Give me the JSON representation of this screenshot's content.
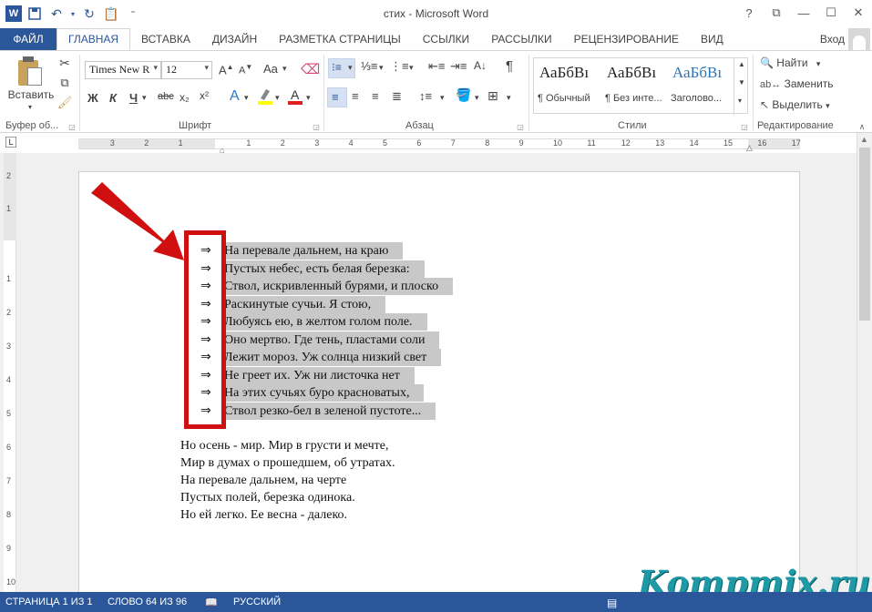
{
  "window": {
    "title": "стих - Microsoft Word",
    "login": "Вход",
    "controls": [
      "?",
      "⧉",
      "—",
      "☐",
      "✕"
    ]
  },
  "tabs": [
    {
      "label": "ФАЙЛ"
    },
    {
      "label": "ГЛАВНАЯ"
    },
    {
      "label": "ВСТАВКА"
    },
    {
      "label": "ДИЗАЙН"
    },
    {
      "label": "РАЗМЕТКА СТРАНИЦЫ"
    },
    {
      "label": "ССЫЛКИ"
    },
    {
      "label": "РАССЫЛКИ"
    },
    {
      "label": "РЕЦЕНЗИРОВАНИЕ"
    },
    {
      "label": "ВИД"
    }
  ],
  "ribbon": {
    "clipboard": {
      "paste_label": "Вставить",
      "group": "Буфер об..."
    },
    "font": {
      "group": "Шрифт",
      "font_name": "Times New R",
      "font_size": "12",
      "bold": "Ж",
      "italic": "К",
      "underline": "Ч",
      "strike": "abc",
      "sub": "x₂",
      "sup": "x²",
      "case": "Aa"
    },
    "paragraph": {
      "group": "Абзац"
    },
    "styles": {
      "group": "Стили",
      "items": [
        {
          "preview": "АаБбВı",
          "name": "¶ Обычный"
        },
        {
          "preview": "АаБбВı",
          "name": "¶ Без инте..."
        },
        {
          "preview": "АаБбВı",
          "name": "Заголово..."
        }
      ]
    },
    "editing": {
      "group": "Редактирование",
      "find": "Найти",
      "replace": "Заменить",
      "select": "Выделить"
    }
  },
  "ruler": {
    "h_numbers": [
      "3",
      "2",
      "1",
      "1",
      "2",
      "3",
      "4",
      "5",
      "6",
      "7",
      "8",
      "9",
      "10",
      "11",
      "12",
      "13",
      "14",
      "15",
      "16",
      "17"
    ],
    "v_numbers": [
      "2",
      "1",
      "1",
      "2",
      "3",
      "4",
      "5",
      "6",
      "7",
      "8",
      "9",
      "10"
    ]
  },
  "document": {
    "bullet_symbol": "⇒",
    "bulleted_lines": [
      "На перевале дальнем, на краю",
      "Пустых небес, есть белая березка:",
      "Ствол, искривленный бурями, и плоско",
      "Раскинутые сучьи. Я стою,",
      "Любуясь ею, в желтом голом поле.",
      "Оно мертво. Где тень, пластами соли",
      "Лежит мороз. Уж солнца низкий свет",
      "Не греет их. Уж ни листочка нет",
      "На этих сучьях буро красноватых,",
      "Ствол резко-бел в зеленой пустоте..."
    ],
    "plain_lines": [
      "Но осень - мир. Мир в грусти и мечте,",
      "Мир в думах о прошедшем, об утратах.",
      "На перевале дальнем, на черте",
      "Пустых полей, березка одинока.",
      "Но ей легко. Ее весна - далеко."
    ]
  },
  "status": {
    "page": "СТРАНИЦА 1 ИЗ 1",
    "words": "СЛОВО 64 ИЗ 96",
    "language": "РУССКИЙ"
  },
  "watermark": "Kompmix.ru",
  "colors": {
    "accent": "#2b579a",
    "selection": "#c8c8c8",
    "highlight_box": "#d01010",
    "watermark": "#1e9aa6"
  }
}
